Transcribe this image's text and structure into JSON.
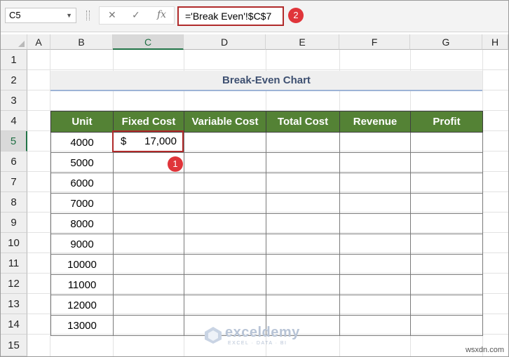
{
  "formula_bar": {
    "name_box": "C5",
    "fx": "fx",
    "formula": "='Break Even'!$C$7"
  },
  "annotations": {
    "badge1": "1",
    "badge2": "2"
  },
  "columns": [
    "A",
    "B",
    "C",
    "D",
    "E",
    "F",
    "G",
    "H"
  ],
  "rows": [
    "1",
    "2",
    "3",
    "4",
    "5",
    "6",
    "7",
    "8",
    "9",
    "10",
    "11",
    "12",
    "13",
    "14",
    "15"
  ],
  "sheet": {
    "title": "Break-Even Chart",
    "headers": [
      "Unit",
      "Fixed Cost",
      "Variable Cost",
      "Total Cost",
      "Revenue",
      "Profit"
    ],
    "units": [
      "4000",
      "5000",
      "6000",
      "7000",
      "8000",
      "9000",
      "10000",
      "11000",
      "12000",
      "13000"
    ],
    "fixed_cost_currency": "$",
    "fixed_cost_value": "17,000"
  },
  "watermark": {
    "name": "exceldemy",
    "tagline": "EXCEL · DATA · BI"
  },
  "brand": "wsxdn.com",
  "colors": {
    "header_green": "#548235",
    "selection_red": "#b02a2a",
    "badge_red": "#e0353a",
    "title_text": "#3e5071"
  }
}
